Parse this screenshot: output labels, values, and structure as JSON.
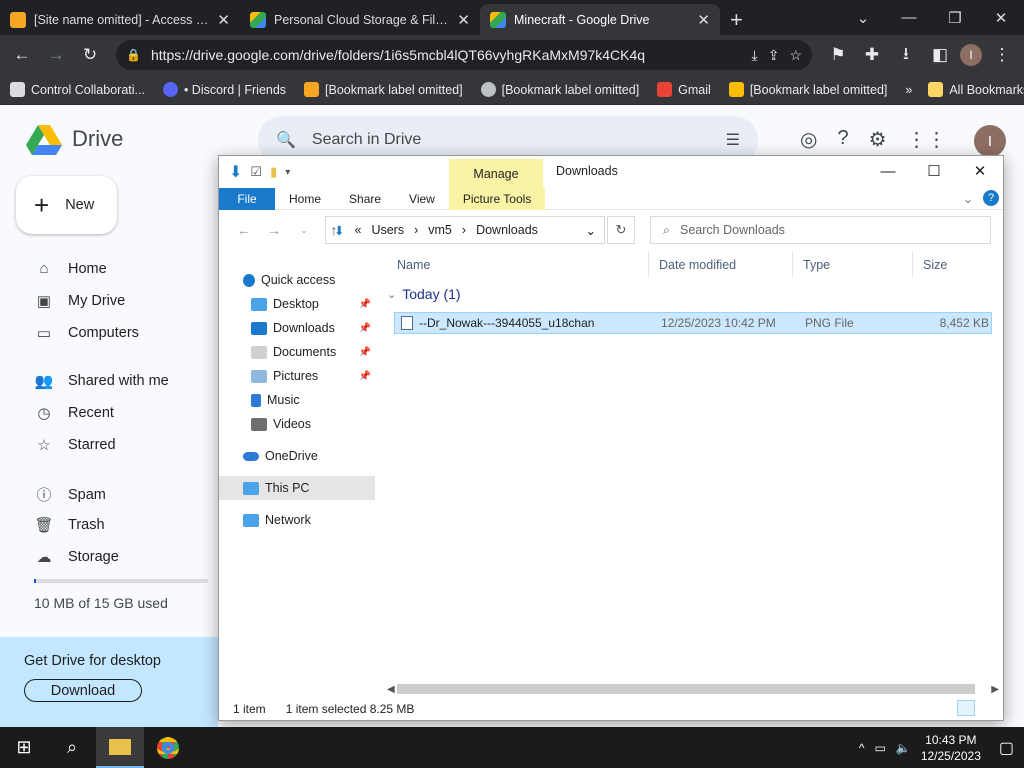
{
  "browser": {
    "tabs": [
      {
        "title": "[Site name omitted] - Access Denied",
        "favicon_color": "#f5a623"
      },
      {
        "title": "Personal Cloud Storage & File Sh",
        "favicon_color": "#fbbc04"
      },
      {
        "title": "Minecraft - Google Drive",
        "favicon_color": "#34a853",
        "active": true
      }
    ],
    "url": "https://drive.google.com/drive/folders/1i6s5mcbl4lQT66vyhgRKaMxM97k4CK4q",
    "bookmarks": [
      {
        "label": "Control Collaborati...",
        "color": "#dadce0"
      },
      {
        "label": "• Discord | Friends",
        "color": "#5865f2"
      },
      {
        "label": "[Bookmark label omitted]",
        "color": "#f5a623"
      },
      {
        "label": "[Bookmark label omitted]",
        "color": "#bdc1c6"
      },
      {
        "label": "Gmail",
        "color": "#ea4335"
      },
      {
        "label": "[Bookmark label omitted]",
        "color": "#fbbc04"
      }
    ],
    "all_bookmarks": "All Bookmarks",
    "profile_initial": "I"
  },
  "drive": {
    "brand": "Drive",
    "search_placeholder": "Search in Drive",
    "new_label": "New",
    "nav": [
      {
        "label": "Home",
        "icon": "home-icon",
        "glyph": "⌂"
      },
      {
        "label": "My Drive",
        "icon": "my-drive-icon",
        "glyph": "▣"
      },
      {
        "label": "Computers",
        "icon": "computers-icon",
        "glyph": "▭"
      },
      {
        "label": "Shared with me",
        "icon": "shared-icon",
        "glyph": "👥"
      },
      {
        "label": "Recent",
        "icon": "clock-icon",
        "glyph": "◷"
      },
      {
        "label": "Starred",
        "icon": "star-icon",
        "glyph": "☆"
      },
      {
        "label": "Spam",
        "icon": "spam-icon",
        "glyph": "ⓘ"
      },
      {
        "label": "Trash",
        "icon": "trash-icon",
        "glyph": "🗑"
      },
      {
        "label": "Storage",
        "icon": "cloud-icon",
        "glyph": "☁"
      }
    ],
    "storage_used": "10 MB of 15 GB used",
    "storage_fraction": 0.0007,
    "promo_title": "Get Drive for desktop",
    "promo_button": "Download"
  },
  "explorer": {
    "manage_tab": "Manage",
    "window_title": "Downloads",
    "ribbon_tabs": [
      "File",
      "Home",
      "Share",
      "View",
      "Picture Tools"
    ],
    "breadcrumb": [
      "Users",
      "vm5",
      "Downloads"
    ],
    "breadcrumb_prefix": "«",
    "search_placeholder": "Search Downloads",
    "nav_items": [
      {
        "label": "Quick access",
        "color": "#1979ca"
      },
      {
        "label": "Desktop",
        "color": "#4aa3e8",
        "pinned": true
      },
      {
        "label": "Downloads",
        "color": "#1979ca",
        "pinned": true
      },
      {
        "label": "Documents",
        "color": "#d0d0d0",
        "pinned": true
      },
      {
        "label": "Pictures",
        "color": "#8fb8de",
        "pinned": true
      },
      {
        "label": "Music",
        "color": "#2d7bd6"
      },
      {
        "label": "Videos",
        "color": "#6e6e6e"
      },
      {
        "label": "OneDrive",
        "color": "#2d7bd6"
      },
      {
        "label": "This PC",
        "color": "#4aa3e8",
        "selected": true
      },
      {
        "label": "Network",
        "color": "#4aa3e8"
      }
    ],
    "columns": [
      "Name",
      "Date modified",
      "Type",
      "Size"
    ],
    "group_label": "Today (1)",
    "files": [
      {
        "name": "--Dr_Nowak---3944055_u18chan",
        "date": "12/25/2023 10:42 PM",
        "type": "PNG File",
        "size": "8,452 KB"
      }
    ],
    "status_count": "1 item",
    "status_selected": "1 item selected  8.25 MB"
  },
  "taskbar": {
    "time": "10:43 PM",
    "date": "12/25/2023"
  }
}
